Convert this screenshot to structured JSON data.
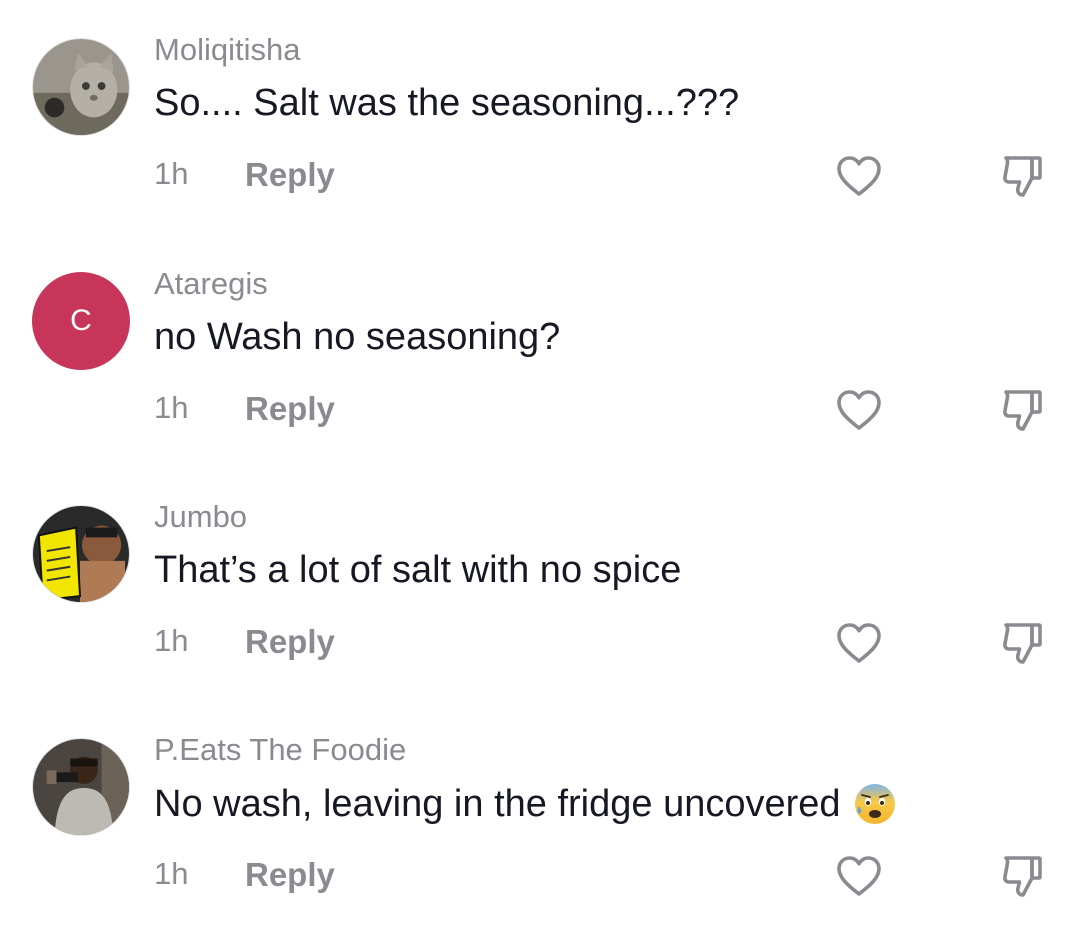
{
  "comments": [
    {
      "username": "Moliqitisha",
      "text": "So.... Salt was the seasoning...???",
      "time": "1h",
      "reply_label": "Reply",
      "avatar": {
        "type": "photo",
        "subject": "cat"
      }
    },
    {
      "username": "Ataregis",
      "text": "no Wash no seasoning?",
      "time": "1h",
      "reply_label": "Reply",
      "avatar": {
        "type": "letter",
        "letter": "C",
        "color": "#c8355a"
      }
    },
    {
      "username": "Jumbo",
      "text": "That’s a lot of salt with no spice",
      "time": "1h",
      "reply_label": "Reply",
      "avatar": {
        "type": "photo",
        "subject": "cartoon-reading-book"
      }
    },
    {
      "username": "P.Eats The Foodie",
      "text": "No wash, leaving in the fridge uncovered",
      "time": "1h",
      "reply_label": "Reply",
      "avatar": {
        "type": "photo",
        "subject": "person"
      },
      "emoji": "anxious-face-with-sweat-icon"
    }
  ],
  "icons": {
    "like": "heart-outline-icon",
    "dislike": "thumbs-down-outline-icon"
  },
  "colors": {
    "secondary_text": "#8a8b91",
    "primary_text": "#161823",
    "letter_avatar": "#c8355a"
  }
}
